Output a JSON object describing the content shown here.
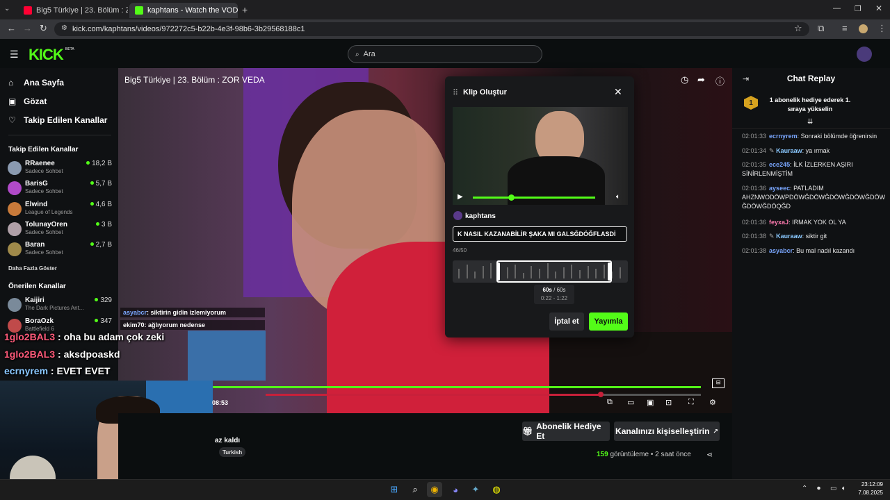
{
  "browser": {
    "tabs": [
      {
        "title": "Big5 Türkiye | 23. Bölüm : ZOR V",
        "favicon_color": "#ff0033"
      },
      {
        "title": "kaphtans - Watch the VOD on K",
        "favicon_color": "#53fc18"
      }
    ],
    "url": "kick.com/kaphtans/videos/972272c5-b22b-4e3f-98b6-3b29568188c1"
  },
  "header": {
    "logo": "KICK",
    "logo_badge": "BETA",
    "search_placeholder": "Ara"
  },
  "sidebar": {
    "nav": [
      {
        "label": "Ana Sayfa",
        "icon": "home-icon"
      },
      {
        "label": "Gözat",
        "icon": "browse-icon"
      },
      {
        "label": "Takip Edilen Kanallar",
        "icon": "heart-icon"
      }
    ],
    "followed_heading": "Takip Edilen Kanallar",
    "followed": [
      {
        "name": "RRaenee",
        "category": "Sadece Sohbet",
        "viewers": "18,2 B",
        "color": "#8a9ab0"
      },
      {
        "name": "BarisG",
        "category": "Sadece Sohbet",
        "viewers": "5,7 B",
        "color": "#b04ac8"
      },
      {
        "name": "Elwind",
        "category": "League of Legends",
        "viewers": "4,6 B",
        "color": "#c87a3a"
      },
      {
        "name": "TolunayOren",
        "category": "Sadece Sohbet",
        "viewers": "3 B",
        "color": "#b0a0a8"
      },
      {
        "name": "Baran",
        "category": "Sadece Sohbet",
        "viewers": "2,7 B",
        "color": "#a08a4a"
      }
    ],
    "show_more": "Daha Fazla Göster",
    "recommended_heading": "Önerilen Kanallar",
    "recommended": [
      {
        "name": "Kaijiri",
        "category": "The Dark Pictures Ant...",
        "viewers": "329",
        "color": "#7a8a9a"
      },
      {
        "name": "BoraOzk",
        "category": "Battlefield 6",
        "viewers": "347",
        "color": "#c04a4a"
      }
    ]
  },
  "video": {
    "title": "Big5 Türkiye | 23. Bölüm : ZOR VEDA",
    "timestamp": "08:53"
  },
  "stream_overlay": {
    "chat_small": [
      {
        "user": "asyabcr",
        "text": ": siktirin gidin izlemiyorum"
      },
      {
        "user": "ekim70",
        "text": ": ağlıyorum nedense"
      }
    ],
    "chat_big": [
      {
        "user": "1glo2BAL3",
        "text": " : oha bu adam çok zeki",
        "blue": false
      },
      {
        "user": "1glo2BAL3",
        "text": " : aksdpoaskd",
        "blue": false
      },
      {
        "user": "ecrnyrem",
        "text": " : EVET EVET",
        "blue": true
      }
    ]
  },
  "clip_modal": {
    "title": "Klip Oluştur",
    "channel": "kaphtans",
    "clip_title_value": "K NASIL KAZANABİLİR ŞAKA MI GALSĞDÖĞFLASDİ",
    "char_count": "46/50",
    "duration": "60s",
    "duration_max": "/ 60s",
    "range": "0:22 - 1:22",
    "cancel_label": "İptal et",
    "publish_label": "Yayımla"
  },
  "below_video": {
    "subscribe_gift_label": "Abonelik Hediye Et",
    "customize_label": "Kanalınızı kişiselleştirin",
    "views_count": "159",
    "views_label": "görüntüleme",
    "time_ago": "2 saat önce",
    "tag": "Turkish",
    "left_text": "az kaldı"
  },
  "chat": {
    "title": "Chat Replay",
    "pinned_text": "1 abonelik hediye ederek 1. sıraya yükselin",
    "pinned_rank": "1",
    "messages": [
      {
        "time": "02:01:33",
        "user": "ecrnyrem",
        "color": "#7aa7ff",
        "text": ": Sonraki bölümde öğrenirsin"
      },
      {
        "time": "02:01:34",
        "user": "Kauraaw",
        "color": "#8ac8ff",
        "text": ": ya ırmak"
      },
      {
        "time": "02:01:35",
        "user": "ece245",
        "color": "#7aa7ff",
        "text": ": İLK İZLERKEN AŞIRI SİNİRLENMİŞTİM"
      },
      {
        "time": "02:01:36",
        "user": "ayseec",
        "color": "#7aa7ff",
        "text": ": PATLADIM AHZNWODÖWPDÖWĞDÖWĞDÖWĞDÖWĞDÖW ĞDÖWĞDÖQĞD"
      },
      {
        "time": "02:01:36",
        "user": "feyxaJ",
        "color": "#ff7ab0",
        "text": ": IRMAK YOK OL YA"
      },
      {
        "time": "02:01:38",
        "user": "Kauraaw",
        "color": "#8ac8ff",
        "text": ": siktir git"
      },
      {
        "time": "02:01:38",
        "user": "asyabcr",
        "color": "#7aa7ff",
        "text": ": Bu mal nadıl kazandı"
      }
    ]
  },
  "taskbar": {
    "time": "23:12:09",
    "date": "7.08.2025"
  }
}
